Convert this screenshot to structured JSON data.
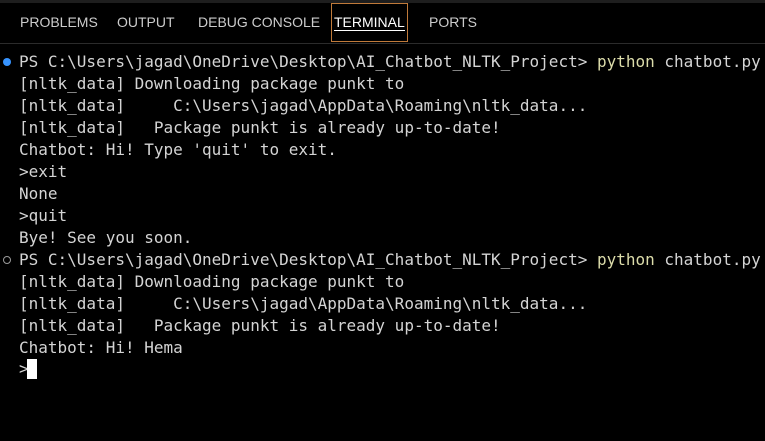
{
  "tabs": {
    "problems": "PROBLEMS",
    "output": "OUTPUT",
    "debug_console": "DEBUG CONSOLE",
    "terminal": "TERMINAL",
    "ports": "PORTS"
  },
  "terminal": {
    "run1": {
      "prompt": "PS C:\\Users\\jagad\\OneDrive\\Desktop\\AI_Chatbot_NLTK_Project> ",
      "command": "python",
      "args": " chatbot.py",
      "out1": "[nltk_data] Downloading package punkt to",
      "out2": "[nltk_data]     C:\\Users\\jagad\\AppData\\Roaming\\nltk_data...",
      "out3": "[nltk_data]   Package punkt is already up-to-date!",
      "out4": "Chatbot: Hi! Type 'quit' to exit.",
      "out5": ">exit",
      "out6": "None",
      "out7": ">quit",
      "out8": "Bye! See you soon."
    },
    "run2": {
      "prompt": "PS C:\\Users\\jagad\\OneDrive\\Desktop\\AI_Chatbot_NLTK_Project> ",
      "command": "python",
      "args": " chatbot.py",
      "out1": "[nltk_data] Downloading package punkt to",
      "out2": "[nltk_data]     C:\\Users\\jagad\\AppData\\Roaming\\nltk_data...",
      "out3": "[nltk_data]   Package punkt is already up-to-date!",
      "out4": "Chatbot: Hi! Hema",
      "input_prompt": ">"
    }
  },
  "colors": {
    "background": "#000000",
    "text": "#d4d4d4",
    "command": "#dcdcaa",
    "active_tab_border": "#c07a3a",
    "success_decoration": "#3794ff"
  }
}
